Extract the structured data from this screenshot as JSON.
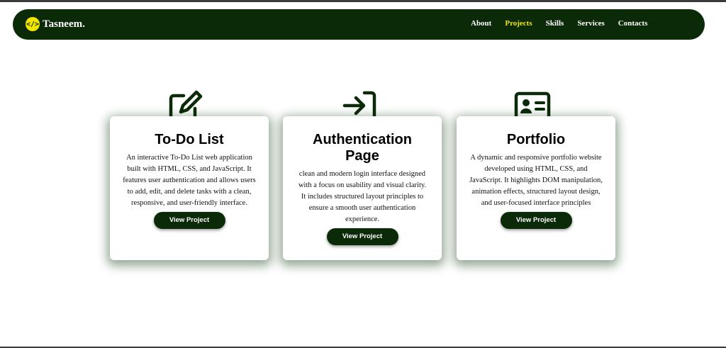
{
  "nav": {
    "brand": "Tasneem.",
    "logo_glyph": "</>",
    "links": [
      "About",
      "Projects",
      "Skills",
      "Services",
      "Contacts"
    ],
    "active": "Projects"
  },
  "cards": [
    {
      "icon": "edit-icon",
      "title": "To-Do List",
      "description": "An interactive To-Do List web application built with HTML, CSS, and JavaScript. It features user authentication and allows users to add, edit, and delete tasks with a clean, responsive, and user-friendly interface.",
      "button": "View Project"
    },
    {
      "icon": "login-icon",
      "title": "Authentication Page",
      "description": "clean and modern login interface designed with a focus on usability and visual clarity. It includes structured layout principles to ensure a smooth user authentication experience.",
      "button": "View Project"
    },
    {
      "icon": "id-card-icon",
      "title": "Portfolio",
      "description": "A dynamic and responsive portfolio website developed using HTML, CSS, and JavaScript. It highlights DOM manipulation, animation effects, structured layout design, and user-focused interface principles",
      "button": "View Project"
    }
  ],
  "colors": {
    "primary": "#0b2a08",
    "accent": "#f2e600"
  }
}
